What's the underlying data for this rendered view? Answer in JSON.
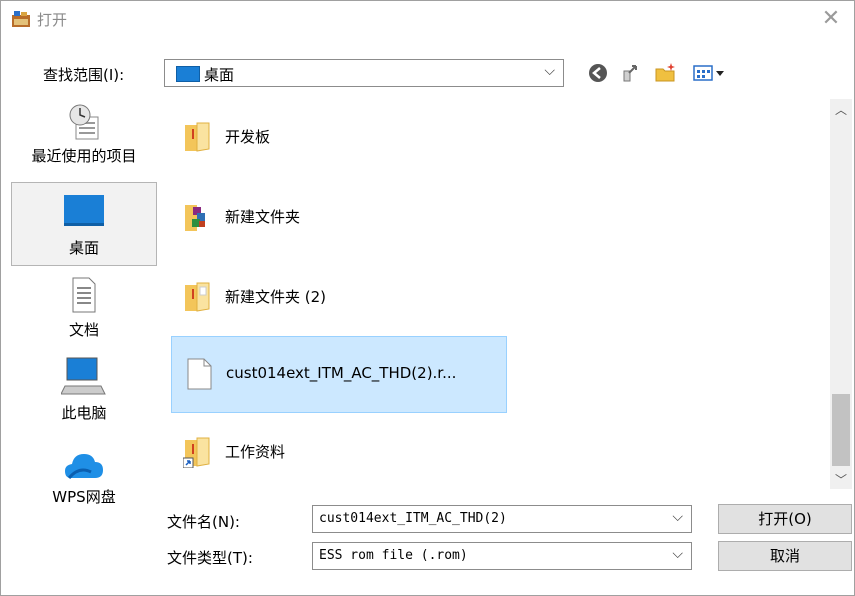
{
  "window": {
    "title": "打开"
  },
  "lookin": {
    "label": "查找范围(I):",
    "value": "桌面"
  },
  "toolbar": {
    "back_icon": "back-icon",
    "up_icon": "up-folder-icon",
    "newfolder_icon": "new-folder-icon",
    "views_icon": "views-menu-icon"
  },
  "places": [
    {
      "label": "最近使用的项目",
      "icon": "recent-items-icon"
    },
    {
      "label": "桌面",
      "icon": "desktop-icon"
    },
    {
      "label": "文档",
      "icon": "documents-icon"
    },
    {
      "label": "此电脑",
      "icon": "computer-icon"
    },
    {
      "label": "WPS网盘",
      "icon": "cloud-icon"
    }
  ],
  "files": [
    {
      "name": "开发板",
      "type": "folder"
    },
    {
      "name": "新建文件夹",
      "type": "folder"
    },
    {
      "name": "新建文件夹 (2)",
      "type": "folder"
    },
    {
      "name": "cust014ext_ITM_AC_THD(2).r...",
      "type": "file"
    },
    {
      "name": "工作资料",
      "type": "folder-shortcut"
    }
  ],
  "filename": {
    "label": "文件名(N):",
    "value": "cust014ext_ITM_AC_THD(2)"
  },
  "filetype": {
    "label": "文件类型(T):",
    "value": "ESS rom file (.rom)"
  },
  "buttons": {
    "open": "打开(O)",
    "cancel": "取消"
  },
  "colors": {
    "selection": "#cce8ff",
    "desktop_blue": "#1a7fd6"
  }
}
